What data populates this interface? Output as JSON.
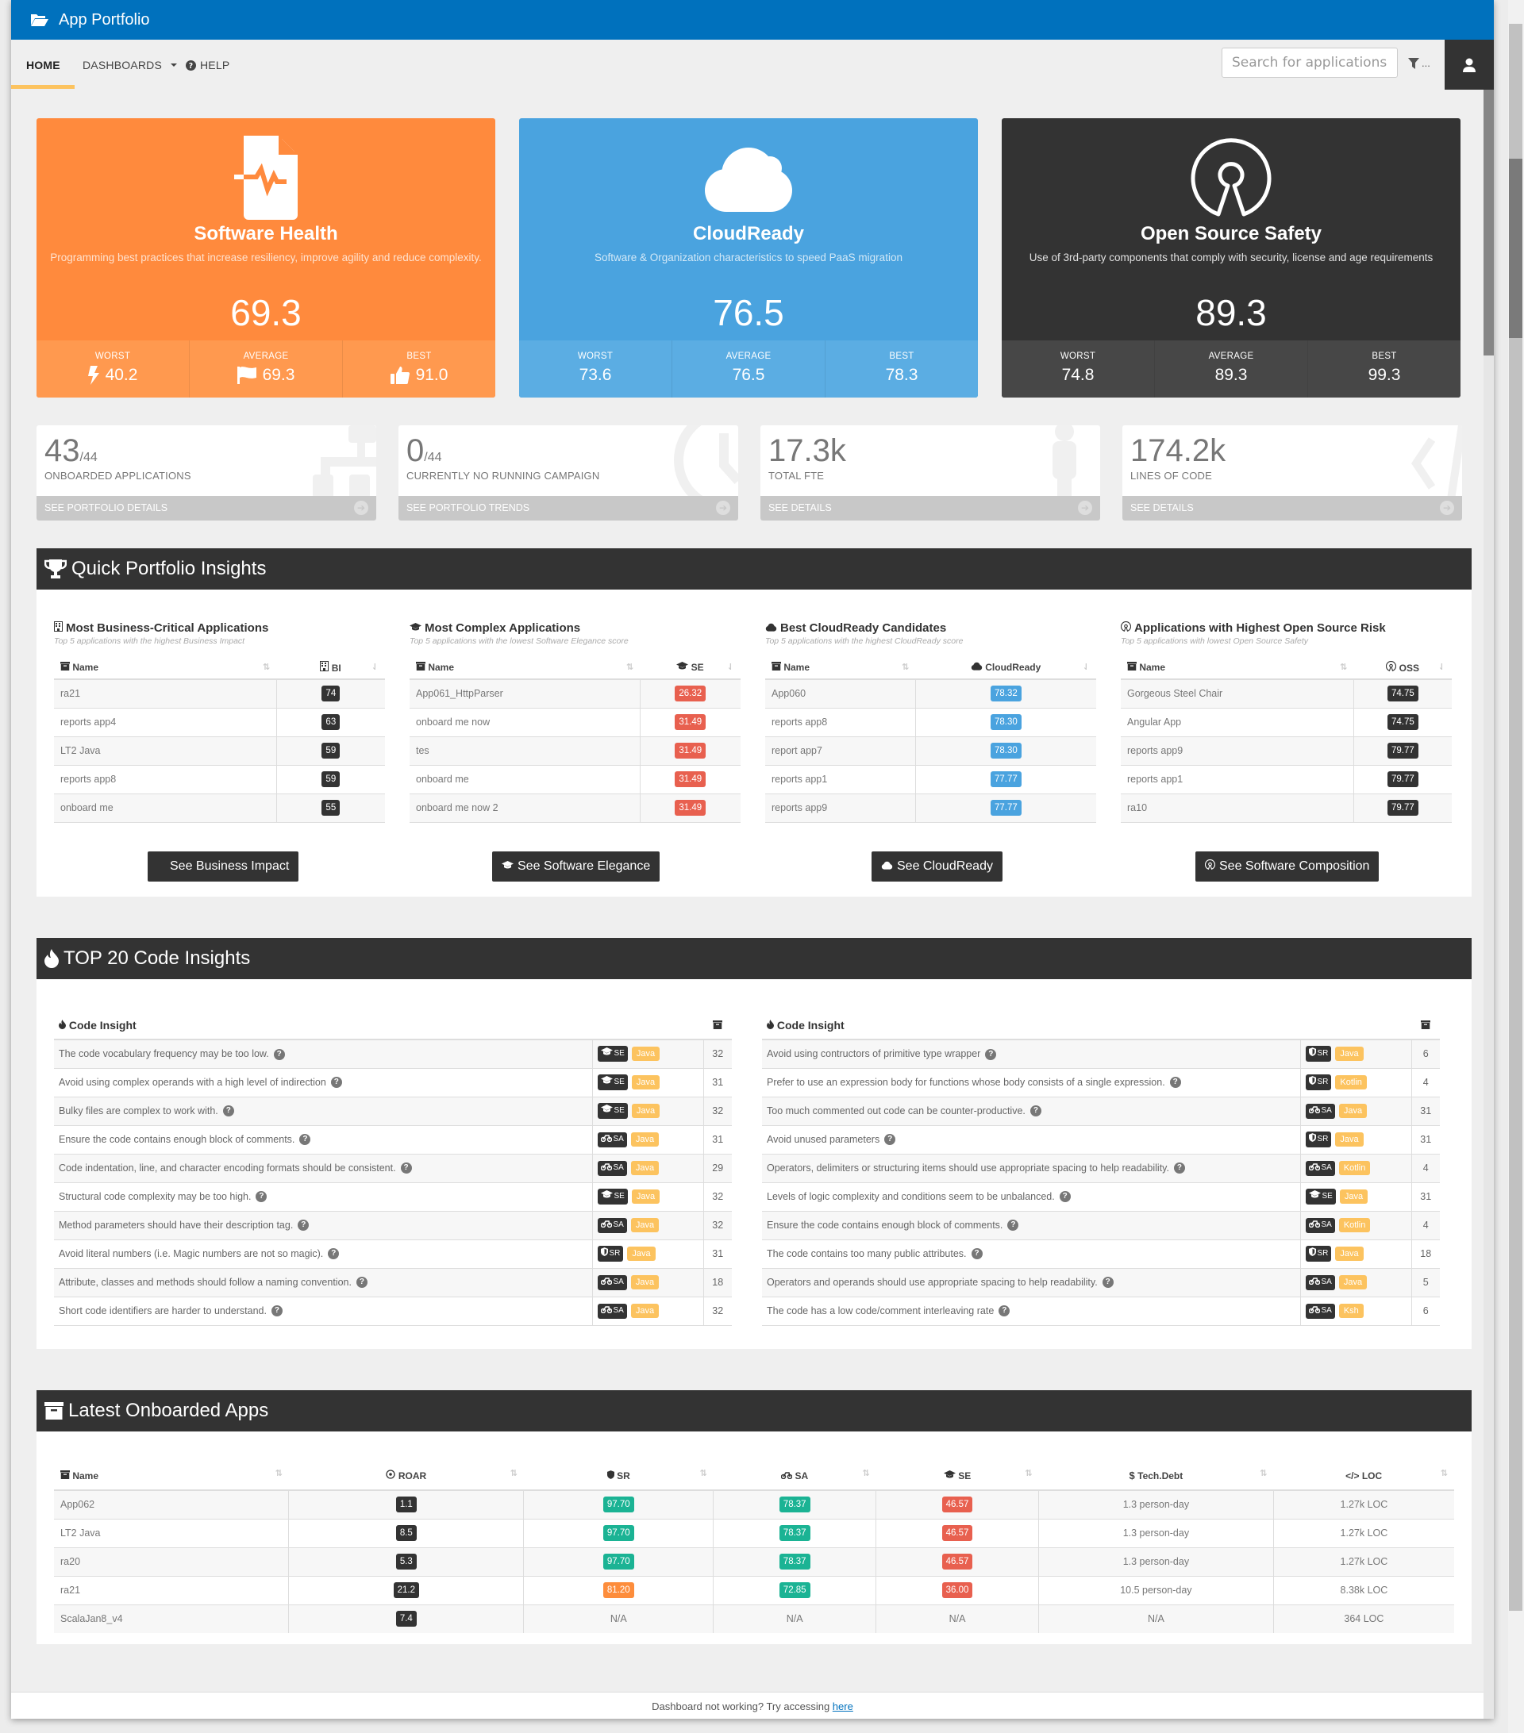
{
  "app": {
    "title": "App Portfolio"
  },
  "nav": {
    "home": "HOME",
    "dashboards": "DASHBOARDS",
    "help": "HELP",
    "search_placeholder": "Search for applications",
    "filter_label": "..."
  },
  "colors": {
    "brand": "#0071bd",
    "health": "#ff8a3d",
    "cloud": "#4aa3df",
    "oss": "#333333",
    "nav_underline": "#fcc35f"
  },
  "cards": [
    {
      "title": "Software Health",
      "desc": "Programming best practices that increase resiliency, improve agility and reduce complexity.",
      "score": "69.3",
      "icon": "file-pulse-icon",
      "stats": [
        {
          "label": "WORST",
          "value": "40.2",
          "icon": "bolt-icon"
        },
        {
          "label": "AVERAGE",
          "value": "69.3",
          "icon": "flag-icon"
        },
        {
          "label": "BEST",
          "value": "91.0",
          "icon": "thumbs-up-icon"
        }
      ]
    },
    {
      "title": "CloudReady",
      "desc": "Software & Organization characteristics to speed PaaS migration",
      "score": "76.5",
      "icon": "cloud-icon",
      "stats": [
        {
          "label": "WORST",
          "value": "73.6"
        },
        {
          "label": "AVERAGE",
          "value": "76.5"
        },
        {
          "label": "BEST",
          "value": "78.3"
        }
      ]
    },
    {
      "title": "Open Source Safety",
      "desc": "Use of 3rd-party components that comply with security, license and age requirements",
      "score": "89.3",
      "icon": "open-source-icon",
      "stats": [
        {
          "label": "WORST",
          "value": "74.8"
        },
        {
          "label": "AVERAGE",
          "value": "89.3"
        },
        {
          "label": "BEST",
          "value": "99.3"
        }
      ]
    }
  ],
  "tiles": [
    {
      "value": "43",
      "suffix": "/44",
      "label": "ONBOARDED APPLICATIONS",
      "link": "SEE PORTFOLIO DETAILS",
      "icon": "sitemap-icon"
    },
    {
      "value": "0",
      "suffix": "/44",
      "label": "CURRENTLY NO RUNNING CAMPAIGN",
      "link": "SEE PORTFOLIO TRENDS",
      "icon": "clock-icon"
    },
    {
      "value": "17.3k",
      "suffix": "",
      "label": "TOTAL FTE",
      "link": "SEE DETAILS",
      "icon": "person-icon"
    },
    {
      "value": "174.2k",
      "suffix": "",
      "label": "LINES OF CODE",
      "link": "SEE DETAILS",
      "icon": "code-icon"
    }
  ],
  "quick_insights": {
    "title": "Quick Portfolio Insights",
    "columns": [
      {
        "title": "Most Business-Critical Applications",
        "subtitle": "Top 5 applications with the highest Business Impact",
        "name_header": "Name",
        "metric_header": "BI",
        "button": "See Business Impact",
        "rows": [
          {
            "name": "ra21",
            "value": "74"
          },
          {
            "name": "reports app4",
            "value": "63"
          },
          {
            "name": "LT2 Java",
            "value": "59"
          },
          {
            "name": "reports app8",
            "value": "59"
          },
          {
            "name": "onboard me",
            "value": "55"
          }
        ]
      },
      {
        "title": "Most Complex Applications",
        "subtitle": "Top 5 applications with the lowest Software Elegance score",
        "name_header": "Name",
        "metric_header": "SE",
        "button": "See Software Elegance",
        "rows": [
          {
            "name": "App061_HttpParser",
            "value": "26.32"
          },
          {
            "name": "onboard me now",
            "value": "31.49"
          },
          {
            "name": "tes",
            "value": "31.49"
          },
          {
            "name": "onboard me",
            "value": "31.49"
          },
          {
            "name": "onboard me now 2",
            "value": "31.49"
          }
        ]
      },
      {
        "title": "Best CloudReady Candidates",
        "subtitle": "Top 5 applications with the highest CloudReady score",
        "name_header": "Name",
        "metric_header": "CloudReady",
        "button": "See CloudReady",
        "rows": [
          {
            "name": "App060",
            "value": "78.32"
          },
          {
            "name": "reports app8",
            "value": "78.30"
          },
          {
            "name": "report app7",
            "value": "78.30"
          },
          {
            "name": "reports app1",
            "value": "77.77"
          },
          {
            "name": "reports app9",
            "value": "77.77"
          }
        ]
      },
      {
        "title": "Applications with Highest Open Source Risk",
        "subtitle": "Top 5 applications with lowest Open Source Safety",
        "name_header": "Name",
        "metric_header": "OSS",
        "button": "See Software Composition",
        "rows": [
          {
            "name": "Gorgeous Steel Chair",
            "value": "74.75"
          },
          {
            "name": "Angular App",
            "value": "74.75"
          },
          {
            "name": "reports app9",
            "value": "79.77"
          },
          {
            "name": "reports app1",
            "value": "79.77"
          },
          {
            "name": "ra10",
            "value": "79.77"
          }
        ]
      }
    ]
  },
  "code_insights": {
    "title": "TOP 20 Code Insights",
    "header": "Code Insight",
    "left": [
      {
        "text": "The code vocabulary frequency may be too low.",
        "cat": "SE",
        "lang": "Java",
        "count": "32"
      },
      {
        "text": "Avoid using complex operands with a high level of indirection",
        "cat": "SE",
        "lang": "Java",
        "count": "31"
      },
      {
        "text": "Bulky files are complex to work with.",
        "cat": "SE",
        "lang": "Java",
        "count": "32"
      },
      {
        "text": "Ensure the code contains enough block of comments.",
        "cat": "SA",
        "lang": "Java",
        "count": "31"
      },
      {
        "text": "Code indentation, line, and character encoding formats should be consistent.",
        "cat": "SA",
        "lang": "Java",
        "count": "29"
      },
      {
        "text": "Structural code complexity may be too high.",
        "cat": "SE",
        "lang": "Java",
        "count": "32"
      },
      {
        "text": "Method parameters should have their description tag.",
        "cat": "SA",
        "lang": "Java",
        "count": "32"
      },
      {
        "text": "Avoid literal numbers (i.e. Magic numbers are not so magic).",
        "cat": "SR",
        "lang": "Java",
        "count": "31"
      },
      {
        "text": "Attribute, classes and methods should follow a naming convention.",
        "cat": "SA",
        "lang": "Java",
        "count": "18"
      },
      {
        "text": "Short code identifiers are harder to understand.",
        "cat": "SA",
        "lang": "Java",
        "count": "32"
      }
    ],
    "right": [
      {
        "text": "Avoid using contructors of primitive type wrapper",
        "cat": "SR",
        "lang": "Java",
        "count": "6"
      },
      {
        "text": "Prefer to use an expression body for functions whose body consists of a single expression.",
        "cat": "SR",
        "lang": "Kotlin",
        "count": "4"
      },
      {
        "text": "Too much commented out code can be counter-productive.",
        "cat": "SA",
        "lang": "Java",
        "count": "31"
      },
      {
        "text": "Avoid unused parameters",
        "cat": "SR",
        "lang": "Java",
        "count": "31"
      },
      {
        "text": "Operators, delimiters or structuring items should use appropriate spacing to help readability.",
        "cat": "SA",
        "lang": "Kotlin",
        "count": "4"
      },
      {
        "text": "Levels of logic complexity and conditions seem to be unbalanced.",
        "cat": "SE",
        "lang": "Java",
        "count": "31"
      },
      {
        "text": "Ensure the code contains enough block of comments.",
        "cat": "SA",
        "lang": "Kotlin",
        "count": "4"
      },
      {
        "text": "The code contains too many public attributes.",
        "cat": "SR",
        "lang": "Java",
        "count": "18"
      },
      {
        "text": "Operators and operands should use appropriate spacing to help readability.",
        "cat": "SA",
        "lang": "Java",
        "count": "5"
      },
      {
        "text": "The code has a low code/comment interleaving rate",
        "cat": "SA",
        "lang": "Ksh",
        "count": "6"
      }
    ]
  },
  "latest": {
    "title": "Latest Onboarded Apps",
    "headers": [
      "Name",
      "ROAR",
      "SR",
      "SA",
      "SE",
      "Tech.Debt",
      "LOC"
    ],
    "rows": [
      {
        "name": "App062",
        "roar": "1.1",
        "sr": "97.70",
        "sr_color": "green",
        "sa": "78.37",
        "se": "46.57",
        "debt": "1.3 person-day",
        "loc": "1.27k LOC"
      },
      {
        "name": "LT2 Java",
        "roar": "8.5",
        "sr": "97.70",
        "sr_color": "green",
        "sa": "78.37",
        "se": "46.57",
        "debt": "1.3 person-day",
        "loc": "1.27k LOC"
      },
      {
        "name": "ra20",
        "roar": "5.3",
        "sr": "97.70",
        "sr_color": "green",
        "sa": "78.37",
        "se": "46.57",
        "debt": "1.3 person-day",
        "loc": "1.27k LOC"
      },
      {
        "name": "ra21",
        "roar": "21.2",
        "sr": "81.20",
        "sr_color": "orange",
        "sa": "72.85",
        "se": "36.00",
        "debt": "10.5 person-day",
        "loc": "8.38k LOC"
      },
      {
        "name": "ScalaJan8_v4",
        "roar": "7.4",
        "sr": "N/A",
        "sr_color": "",
        "sa": "N/A",
        "se": "N/A",
        "debt": "N/A",
        "loc": "364 LOC"
      }
    ]
  },
  "footer": {
    "text": "Dashboard not working? Try accessing ",
    "link": "here"
  }
}
